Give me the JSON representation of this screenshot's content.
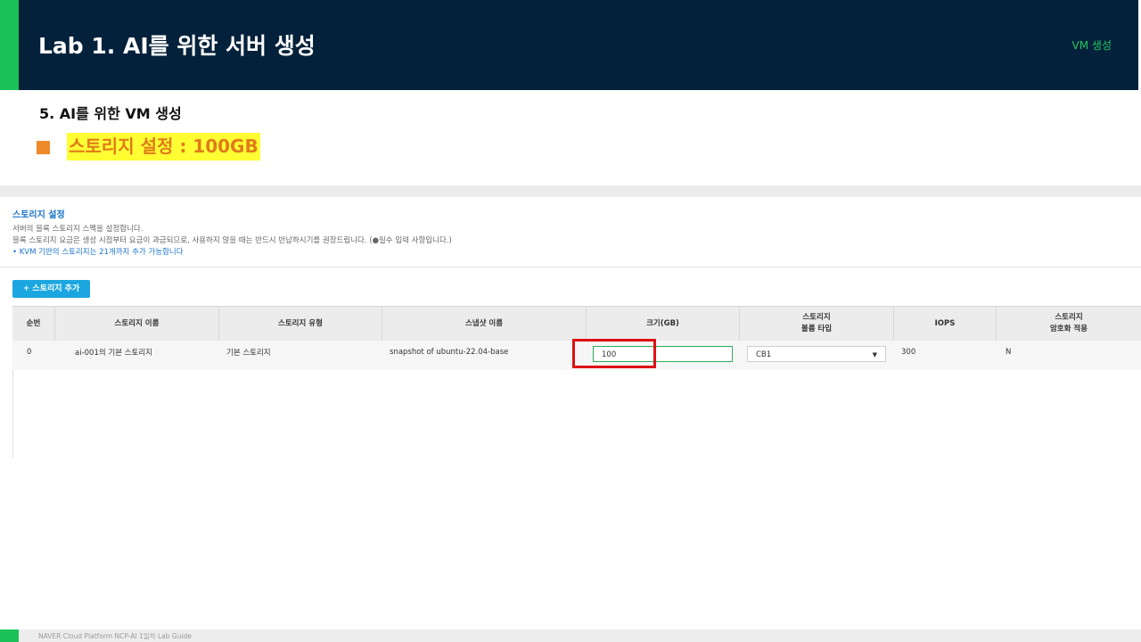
{
  "header": {
    "title": "Lab 1. AI를 위한 서버 생성",
    "tag": "VM 생성"
  },
  "slide": {
    "step": "5.  AI를 위한 VM 생성",
    "highlight": "스토리지 설정 : 100GB"
  },
  "panel": {
    "title": "스토리지 설정",
    "desc1": "서버의 블록 스토리지 스펙을 설정합니다.",
    "desc2": "블록 스토리지 요금은 생성 시점부터 요금이 과금되므로, 사용하지 않을 때는 반드시 반납하시기를 권장드립니다. (●필수 입력 사항입니다.)",
    "note": "•  KVM 기반의 스토리지는 21개까지 추가 가능합니다",
    "add_button": "+ 스토리지 추가"
  },
  "table": {
    "headers": {
      "seq": "순번",
      "name": "스토리지 이름",
      "type": "스토리지 유형",
      "snapshot": "스냅샷 이름",
      "size": "크기(GB)",
      "volume_type_1": "스토리지",
      "volume_type_2": "볼륨 타입",
      "iops": "IOPS",
      "encrypt_1": "스토리지",
      "encrypt_2": "암호화 적용"
    },
    "row": {
      "seq": "0",
      "name": "ai-001의 기본 스토리지",
      "type": "기본 스토리지",
      "snapshot": "snapshot of ubuntu-22.04-base",
      "size": "100",
      "volume_type": "CB1",
      "iops": "300",
      "encrypt": "N"
    }
  },
  "footer": {
    "text": "NAVER Cloud Platform  NCP-AI 1일차 Lab Guide"
  },
  "colors": {
    "header_bg": "#04213b",
    "accent_green": "#1bc257",
    "highlight_bg": "#ffff33",
    "highlight_text": "#e07b1a",
    "button_blue": "#1ba6e0",
    "callout_red": "#dd1111"
  }
}
